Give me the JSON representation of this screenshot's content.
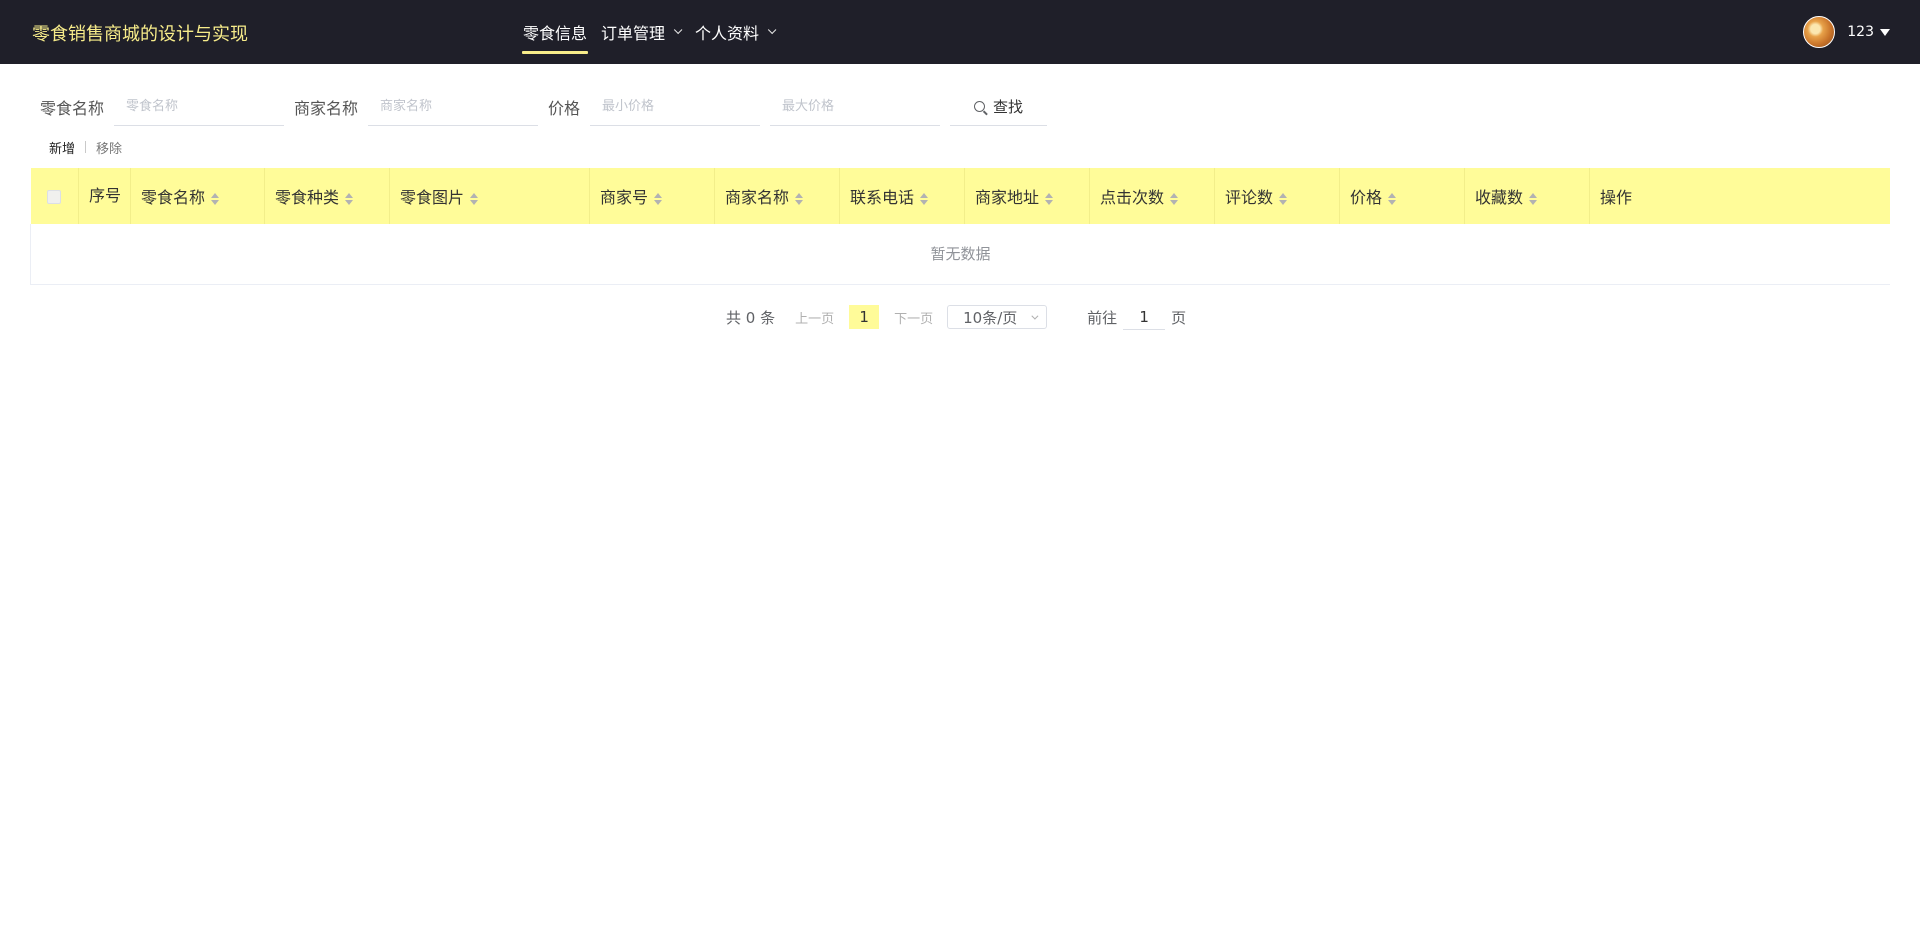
{
  "header": {
    "title": "零食销售商城的设计与实现",
    "nav": [
      {
        "label": "零食信息",
        "active": true,
        "dropdown": false
      },
      {
        "label": "订单管理",
        "active": false,
        "dropdown": true
      },
      {
        "label": "个人资料",
        "active": false,
        "dropdown": true
      }
    ],
    "username": "123"
  },
  "search": {
    "snack_name_label": "零食名称",
    "snack_name_placeholder": "零食名称",
    "merchant_name_label": "商家名称",
    "merchant_name_placeholder": "商家名称",
    "price_label": "价格",
    "min_price_placeholder": "最小价格",
    "max_price_placeholder": "最大价格",
    "search_button": "查找"
  },
  "actions": {
    "add": "新增",
    "remove": "移除"
  },
  "table": {
    "index_header": "序号",
    "columns": [
      "零食名称",
      "零食种类",
      "零食图片",
      "商家号",
      "商家名称",
      "联系电话",
      "商家地址",
      "点击次数",
      "评论数",
      "价格",
      "收藏数"
    ],
    "operation_header": "操作",
    "empty_text": "暂无数据"
  },
  "pagination": {
    "total": "共 0 条",
    "prev": "上一页",
    "current_page": "1",
    "next": "下一页",
    "page_size": "10条/页",
    "goto_label": "前往",
    "goto_value": "1",
    "goto_suffix": "页"
  },
  "colors": {
    "header_bg": "#1f1f29",
    "accent_yellow": "#f7ec8a",
    "table_header_bg": "#fffc99"
  }
}
